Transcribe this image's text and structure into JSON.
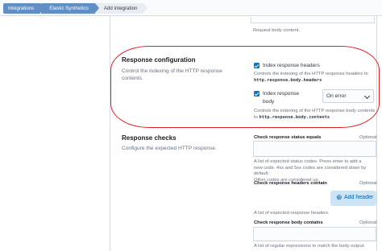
{
  "breadcrumbs": [
    "Integrations",
    "Elastic Synthetics",
    "Add integration"
  ],
  "previous_field": {
    "help": "Request body content."
  },
  "response_configuration": {
    "title": "Response configuration",
    "description": "Control the indexing of the HTTP response contents.",
    "index_headers": {
      "checked": true,
      "label": "Index response headers",
      "help_prefix": "Controls the indexing of the HTTP response headers to",
      "help_code": "http.response.body.headers"
    },
    "index_body": {
      "checked": true,
      "label_line1": "Index response",
      "label_line2": "body",
      "select_value": "On error",
      "help_prefix": "Controls the indexing of the HTTP response body contents",
      "help_to": "to",
      "help_code": "http.response.body.contents"
    }
  },
  "response_checks": {
    "title": "Response checks",
    "description": "Configure the expected HTTP response.",
    "status_equals": {
      "label": "Check response status equals",
      "optional": "Optional",
      "value": "",
      "help_line1": "A list of expected status codes. Press enter to add a",
      "help_line2": "new code. 4xx and 5xx codes are considered down by default.",
      "help_line3": "Other codes are considered up."
    },
    "headers_contain": {
      "label": "Check response headers contain",
      "optional": "Optional",
      "add_button": "Add header",
      "add_icon": "plus-circle-icon",
      "help": "A list of expected response headers."
    },
    "body_contains": {
      "label": "Check response body contains",
      "optional": "Optional",
      "value": "",
      "help": "A list of regular expressions to match the body output."
    }
  },
  "colors": {
    "accent": "#0077cc",
    "annotation": "#e0202a",
    "breadcrumb_link": "#5f8fc4"
  }
}
